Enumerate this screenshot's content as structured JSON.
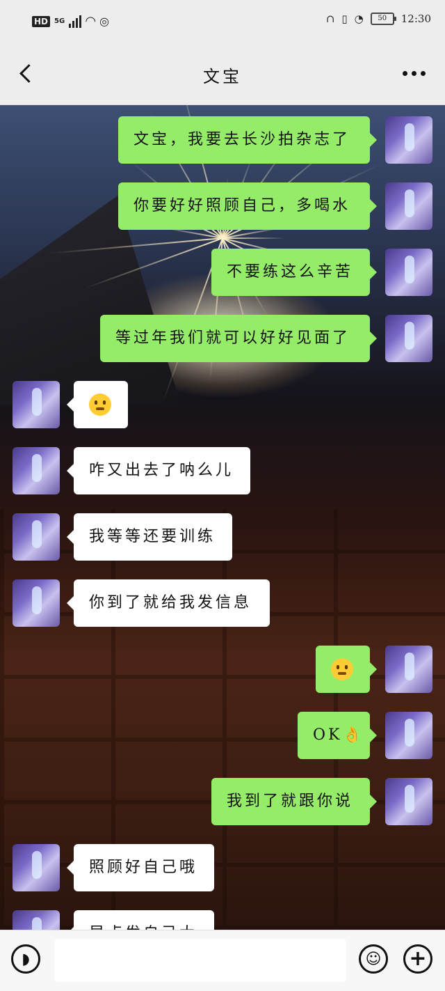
{
  "status_bar": {
    "hd": "HD",
    "network": "5G",
    "battery": "50",
    "time": "12:30",
    "icons": [
      "wifi-icon",
      "signal-icon",
      "headphones-icon",
      "vibrate-icon",
      "speed-icon"
    ]
  },
  "header": {
    "title": "文宝",
    "back_icon": "chevron-left-icon",
    "more_icon": "more-dots-icon"
  },
  "messages": [
    {
      "side": "out",
      "text": "文宝，我要去长沙拍杂志了"
    },
    {
      "side": "out",
      "text": "你要好好照顾自己，多喝水"
    },
    {
      "side": "out",
      "text": "不要练这么辛苦"
    },
    {
      "side": "out",
      "text": "等过年我们就可以好好见面了"
    },
    {
      "side": "in",
      "text": "",
      "emoji": "worried-emoji"
    },
    {
      "side": "in",
      "text": "咋又出去了呐么儿"
    },
    {
      "side": "in",
      "text": "我等等还要训练"
    },
    {
      "side": "in",
      "text": "你到了就给我发信息"
    },
    {
      "side": "out",
      "text": "",
      "emoji": "laughing-emoji"
    },
    {
      "side": "out",
      "text": "OK👌"
    },
    {
      "side": "out",
      "text": "我到了就跟你说"
    },
    {
      "side": "in",
      "text": "照顾好自己哦"
    },
    {
      "side": "in",
      "text": "早点发自己大"
    }
  ],
  "bottom_bar": {
    "voice_icon": "voice-icon",
    "input_value": "",
    "emoji_icon": "emoji-icon",
    "plus_icon": "plus-icon",
    "plus_glyph": "+"
  },
  "colors": {
    "outgoing_bubble": "#95ec69",
    "incoming_bubble": "#ffffff",
    "bar_bg": "#ededed"
  }
}
